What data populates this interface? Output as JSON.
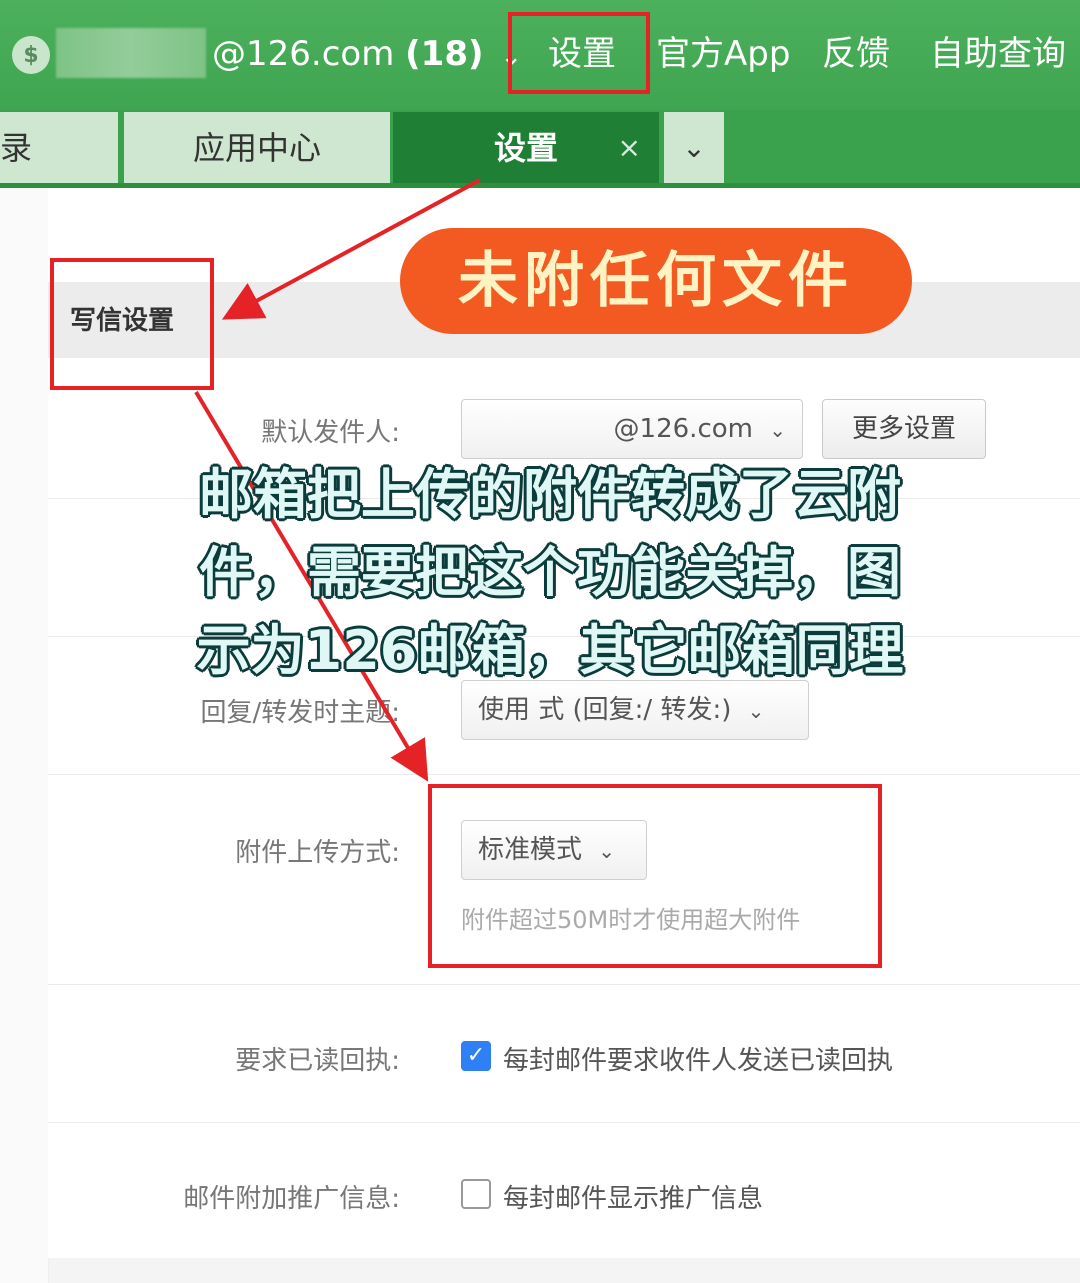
{
  "header": {
    "logo_icon": "dollar-circle-icon",
    "account_email": "@126.com",
    "account_count": "(18)",
    "nav": [
      "设置",
      "官方App",
      "反馈",
      "自助查询"
    ]
  },
  "tabs": {
    "items": [
      {
        "label": "录"
      },
      {
        "label": "应用中心"
      },
      {
        "label": "设置",
        "active": true
      }
    ],
    "close_glyph": "×",
    "more_glyph": "⌄"
  },
  "annotation_banner": "未附任何文件",
  "section": {
    "title": "写信设置"
  },
  "settings": {
    "default_sender": {
      "label": "默认发件人:",
      "value": "@126.com",
      "more_button": "更多设置"
    },
    "reply_subject": {
      "label": "回复/转发时主题:",
      "value": "使用 式 (回复:/ 转发:)"
    },
    "attachment_upload": {
      "label": "附件上传方式:",
      "value": "标准模式",
      "hint": "附件超过50M时才使用超大附件"
    },
    "read_receipt": {
      "label": "要求已读回执:",
      "checked": true,
      "text": "每封邮件要求收件人发送已读回执"
    },
    "promo_info": {
      "label": "邮件附加推广信息:",
      "checked": false,
      "text": "每封邮件显示推广信息"
    }
  },
  "overlay_text": "邮箱把上传的附件转成了云附件，需要把这个功能关掉，图示为126邮箱，其它邮箱同理",
  "colors": {
    "accent_green": "#3fa550",
    "highlight_red": "#e52327",
    "banner_orange": "#f25a22",
    "checkbox_blue": "#2f7ff7"
  }
}
